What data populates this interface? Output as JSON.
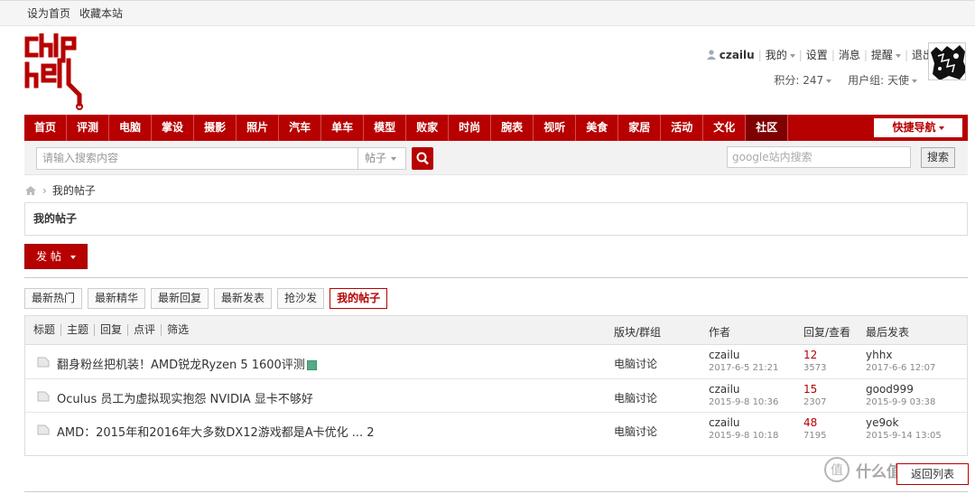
{
  "topbar": {
    "set_home": "设为首页",
    "bookmark": "收藏本站"
  },
  "user": {
    "name": "czailu",
    "my": "我的",
    "settings": "设置",
    "messages": "消息",
    "remind": "提醒",
    "logout": "退出",
    "points": "积分: 247",
    "group": "用户组: 天使"
  },
  "nav": {
    "items": [
      "首页",
      "评测",
      "电脑",
      "掌设",
      "摄影",
      "照片",
      "汽车",
      "单车",
      "模型",
      "败家",
      "时尚",
      "腕表",
      "视听",
      "美食",
      "家居",
      "活动",
      "文化",
      "社区"
    ],
    "active_index": 17,
    "quick_nav": "快捷导航"
  },
  "search": {
    "placeholder": "请输入搜索内容",
    "type": "帖子",
    "google_placeholder": "google站内搜索",
    "google_button": "搜索"
  },
  "breadcrumb": {
    "current": "我的帖子"
  },
  "page_title": "我的帖子",
  "post_button": "发 帖",
  "tabs": [
    {
      "label": "最新热门"
    },
    {
      "label": "最新精华"
    },
    {
      "label": "最新回复"
    },
    {
      "label": "最新发表"
    },
    {
      "label": "抢沙发"
    },
    {
      "label": "我的帖子",
      "active": true
    }
  ],
  "table": {
    "filters": [
      "标题",
      "主题",
      "回复",
      "点评",
      "筛选"
    ],
    "col_forum": "版块/群组",
    "col_author": "作者",
    "col_replies": "回复/查看",
    "col_last": "最后发表",
    "rows": [
      {
        "title": "翻身粉丝把机装！AMD锐龙Ryzen 5 1600评测",
        "has_attach": true,
        "forum": "电脑讨论",
        "author": "czailu",
        "date": "2017-6-5 21:21",
        "replies": "12",
        "views": "3573",
        "last_user": "yhhx",
        "last_date": "2017-6-6 12:07"
      },
      {
        "title": "Oculus 员工为虚拟现实抱怨 NVIDIA 显卡不够好",
        "has_attach": false,
        "forum": "电脑讨论",
        "author": "czailu",
        "date": "2015-9-8 10:36",
        "replies": "15",
        "views": "2307",
        "last_user": "good999",
        "last_date": "2015-9-9 03:38"
      },
      {
        "title": "AMD：2015年和2016年大多数DX12游戏都是A卡优化 ... 2",
        "has_attach": false,
        "forum": "电脑讨论",
        "author": "czailu",
        "date": "2015-9-8 10:18",
        "replies": "48",
        "views": "7195",
        "last_user": "ye9ok",
        "last_date": "2015-9-14 13:05"
      }
    ]
  },
  "return_button": "返回列表",
  "watermark": "什么值得买",
  "colors": {
    "brand": "#b70000",
    "nav_active": "#7f0000"
  }
}
